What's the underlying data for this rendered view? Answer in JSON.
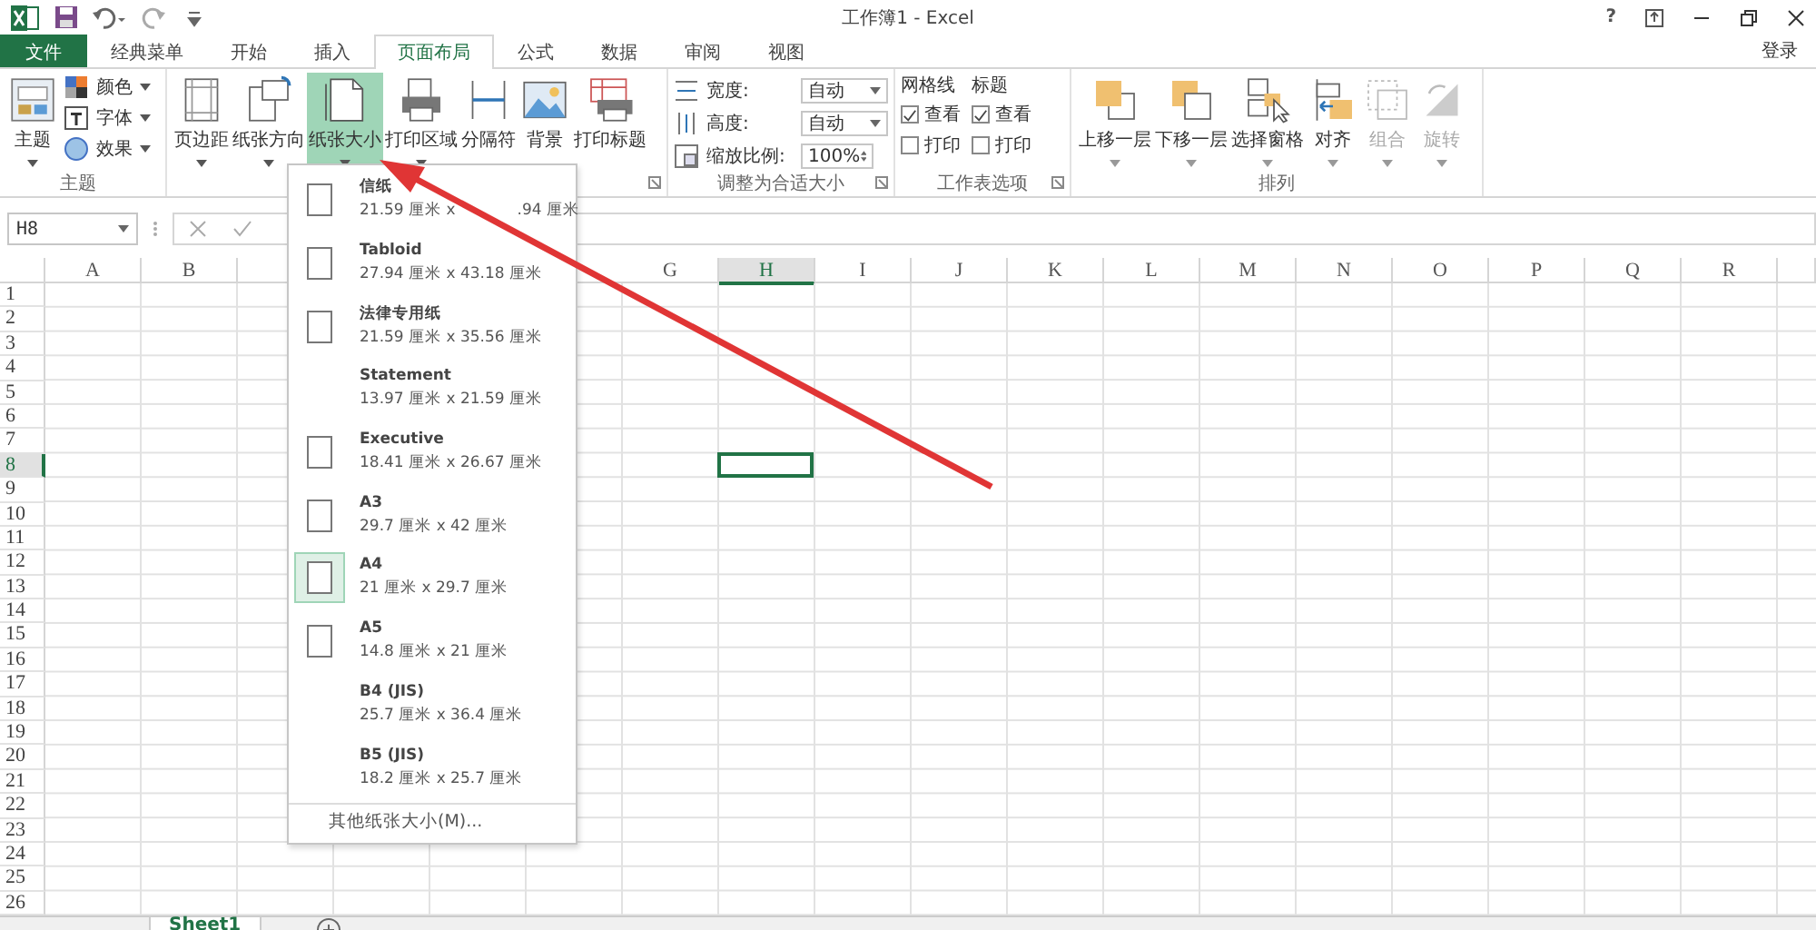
{
  "window": {
    "title": "工作簿1 - Excel",
    "help": "?"
  },
  "tabs": [
    {
      "label": "文件",
      "kind": "file",
      "selected": false
    },
    {
      "label": "经典菜单",
      "kind": "tab",
      "selected": false
    },
    {
      "label": "开始",
      "kind": "tab",
      "selected": false
    },
    {
      "label": "插入",
      "kind": "tab",
      "selected": false
    },
    {
      "label": "页面布局",
      "kind": "tab",
      "selected": true
    },
    {
      "label": "公式",
      "kind": "tab",
      "selected": false
    },
    {
      "label": "数据",
      "kind": "tab",
      "selected": false
    },
    {
      "label": "审阅",
      "kind": "tab",
      "selected": false
    },
    {
      "label": "视图",
      "kind": "tab",
      "selected": false
    }
  ],
  "sign_in": "登录",
  "ribbon": {
    "theme": {
      "label": "主题",
      "large": {
        "label": "主题"
      },
      "small": [
        {
          "label": "颜色"
        },
        {
          "label": "字体"
        },
        {
          "label": "效果"
        }
      ]
    },
    "page_setup": {
      "buttons": [
        {
          "label": "页边距",
          "selected": false
        },
        {
          "label": "纸张方向",
          "selected": false
        },
        {
          "label": "纸张大小",
          "selected": true
        },
        {
          "label": "打印区域",
          "selected": false
        },
        {
          "label": "分隔符",
          "selected": false
        },
        {
          "label": "背景",
          "selected": false
        },
        {
          "label": "打印标题",
          "selected": false
        }
      ]
    },
    "scale": {
      "label": "调整为合适大小",
      "fields": [
        {
          "label": "宽度:",
          "value": "自动",
          "kind": "select"
        },
        {
          "label": "高度:",
          "value": "自动",
          "kind": "select"
        },
        {
          "label": "缩放比例:",
          "value": "100%",
          "kind": "spin"
        }
      ]
    },
    "sheet_options": {
      "label": "工作表选项",
      "columns": [
        {
          "heading": "网格线",
          "options": [
            {
              "label": "查看",
              "checked": true
            },
            {
              "label": "打印",
              "checked": false
            }
          ]
        },
        {
          "heading": "标题",
          "options": [
            {
              "label": "查看",
              "checked": true
            },
            {
              "label": "打印",
              "checked": false
            }
          ]
        }
      ]
    },
    "arrange": {
      "label": "排列",
      "buttons": [
        {
          "label": "上移一层",
          "disabled": false
        },
        {
          "label": "下移一层",
          "disabled": false
        },
        {
          "label": "选择窗格",
          "disabled": false
        },
        {
          "label": "对齐",
          "disabled": false
        },
        {
          "label": "组合",
          "disabled": true
        },
        {
          "label": "旋转",
          "disabled": true
        }
      ]
    }
  },
  "formula_bar": {
    "name_box": "H8"
  },
  "sheet": {
    "columns": [
      {
        "label": "A",
        "selected": false
      },
      {
        "label": "B",
        "selected": false
      },
      {
        "label": "G",
        "selected": false
      },
      {
        "label": "H",
        "selected": true
      },
      {
        "label": "I",
        "selected": false
      },
      {
        "label": "J",
        "selected": false
      },
      {
        "label": "K",
        "selected": false
      },
      {
        "label": "L",
        "selected": false
      },
      {
        "label": "M",
        "selected": false
      },
      {
        "label": "N",
        "selected": false
      },
      {
        "label": "O",
        "selected": false
      },
      {
        "label": "P",
        "selected": false
      },
      {
        "label": "Q",
        "selected": false
      },
      {
        "label": "R",
        "selected": false
      }
    ],
    "rows": [
      {
        "label": "1",
        "selected": false
      },
      {
        "label": "2",
        "selected": false
      },
      {
        "label": "3",
        "selected": false
      },
      {
        "label": "4",
        "selected": false
      },
      {
        "label": "5",
        "selected": false
      },
      {
        "label": "6",
        "selected": false
      },
      {
        "label": "7",
        "selected": false
      },
      {
        "label": "8",
        "selected": true
      },
      {
        "label": "9",
        "selected": false
      },
      {
        "label": "10",
        "selected": false
      },
      {
        "label": "11",
        "selected": false
      },
      {
        "label": "12",
        "selected": false
      },
      {
        "label": "13",
        "selected": false
      },
      {
        "label": "14",
        "selected": false
      },
      {
        "label": "15",
        "selected": false
      },
      {
        "label": "16",
        "selected": false
      },
      {
        "label": "17",
        "selected": false
      },
      {
        "label": "18",
        "selected": false
      },
      {
        "label": "19",
        "selected": false
      },
      {
        "label": "20",
        "selected": false
      },
      {
        "label": "21",
        "selected": false
      },
      {
        "label": "22",
        "selected": false
      },
      {
        "label": "23",
        "selected": false
      },
      {
        "label": "24",
        "selected": false
      },
      {
        "label": "25",
        "selected": false
      },
      {
        "label": "26",
        "selected": false
      }
    ],
    "tabs": [
      {
        "label": "Sheet1",
        "selected": true
      }
    ]
  },
  "paper_menu": {
    "items": [
      {
        "name": "信纸",
        "size": "21.59 厘米 x",
        "size_after_arrow": ".94 厘米",
        "icon": true,
        "selected": false
      },
      {
        "name": "Tabloid",
        "size": "27.94 厘米 x 43.18 厘米",
        "icon": true,
        "selected": false
      },
      {
        "name": "法律专用纸",
        "size": "21.59 厘米 x 35.56 厘米",
        "icon": true,
        "selected": false
      },
      {
        "name": "Statement",
        "size": "13.97 厘米 x 21.59 厘米",
        "icon": false,
        "selected": false
      },
      {
        "name": "Executive",
        "size": "18.41 厘米 x 26.67 厘米",
        "icon": true,
        "selected": false
      },
      {
        "name": "A3",
        "size": "29.7 厘米 x 42 厘米",
        "icon": true,
        "selected": false
      },
      {
        "name": "A4",
        "size": "21 厘米 x 29.7 厘米",
        "icon": true,
        "selected": true
      },
      {
        "name": "A5",
        "size": "14.8 厘米 x 21 厘米",
        "icon": true,
        "selected": false
      },
      {
        "name": "B4 (JIS)",
        "size": "25.7 厘米 x 36.4 厘米",
        "icon": false,
        "selected": false
      },
      {
        "name": "B5 (JIS)",
        "size": "18.2 厘米 x 25.7 厘米",
        "icon": false,
        "selected": false
      }
    ],
    "footer": "其他纸张大小(M)..."
  }
}
